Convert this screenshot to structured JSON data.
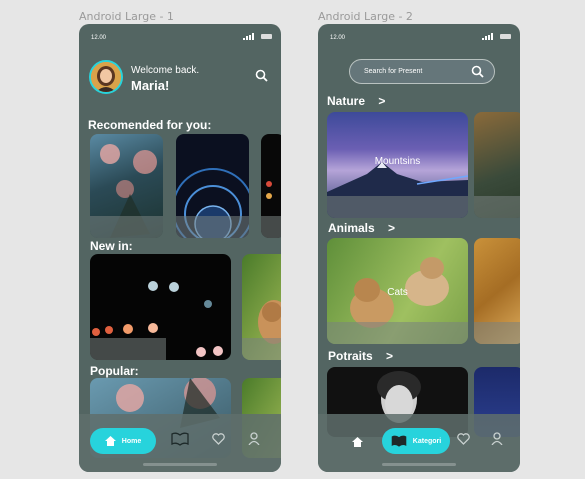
{
  "frames": [
    {
      "label": "Android Large - 1",
      "status_time": "12.00",
      "welcome_small": "Welcome back.",
      "welcome_name": "Maria!",
      "sections": {
        "recommended": "Recomended for you:",
        "new_in": "New in:",
        "popular": "Popular:"
      },
      "bottom_nav": {
        "home_label": "Home"
      },
      "icons": [
        "search-icon",
        "home-icon",
        "book-icon",
        "heart-icon",
        "person-icon"
      ]
    },
    {
      "label": "Android Large - 2",
      "status_time": "12.00",
      "search_placeholder": "Search for Present",
      "categories": [
        {
          "title": "Nature",
          "arrow": ">",
          "card_label": "Mountsins"
        },
        {
          "title": "Animals",
          "arrow": ">",
          "card_label": "Cats"
        },
        {
          "title": "Potraits",
          "arrow": ">"
        }
      ],
      "bottom_nav": {
        "kategori_label": "Kategori"
      },
      "icons": [
        "home-icon",
        "book-icon",
        "heart-icon",
        "person-icon",
        "search-icon"
      ]
    }
  ],
  "colors": {
    "accent": "#27d3dc",
    "phone_bg": "#536562",
    "page_bg": "#e6e6e6"
  }
}
